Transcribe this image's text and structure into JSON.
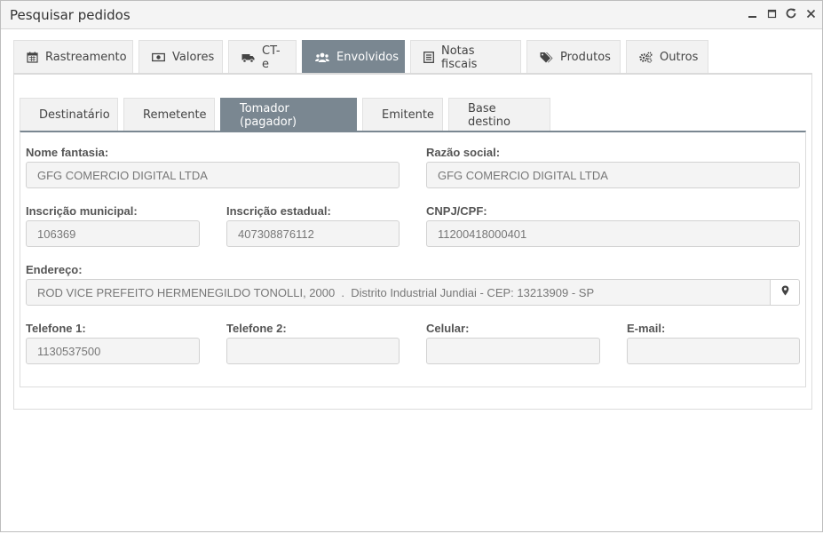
{
  "window": {
    "title": "Pesquisar pedidos",
    "controls": [
      "minimize-icon",
      "maximize-icon",
      "refresh-icon",
      "close-icon"
    ]
  },
  "outer_tabs": [
    {
      "label": "Rastreamento",
      "icon": "calendar-icon"
    },
    {
      "label": "Valores",
      "icon": "money-icon"
    },
    {
      "label": "CT-e",
      "icon": "truck-icon"
    },
    {
      "label": "Envolvidos",
      "icon": "users-icon",
      "active": true
    },
    {
      "label": "Notas fiscais",
      "icon": "list-icon"
    },
    {
      "label": "Produtos",
      "icon": "tags-icon"
    },
    {
      "label": "Outros",
      "icon": "cogs-icon"
    }
  ],
  "inner_tabs": [
    {
      "label": "Destinatário"
    },
    {
      "label": "Remetente"
    },
    {
      "label": "Tomador (pagador)",
      "active": true
    },
    {
      "label": "Emitente"
    },
    {
      "label": "Base destino"
    }
  ],
  "form": {
    "nome_fantasia": {
      "label": "Nome fantasia:",
      "value": "GFG COMERCIO DIGITAL LTDA"
    },
    "razao_social": {
      "label": "Razão social:",
      "value": "GFG COMERCIO DIGITAL LTDA"
    },
    "inscricao_municipal": {
      "label": "Inscrição municipal:",
      "value": "106369"
    },
    "inscricao_estadual": {
      "label": "Inscrição estadual:",
      "value": "407308876112"
    },
    "cnpj_cpf": {
      "label": "CNPJ/CPF:",
      "value": "11200418000401"
    },
    "endereco": {
      "label": "Endereço:",
      "value": "ROD VICE PREFEITO HERMENEGILDO TONOLLI, 2000  .  Distrito Industrial Jundiai - CEP: 13213909 - SP"
    },
    "telefone1": {
      "label": "Telefone 1:",
      "value": "1130537500"
    },
    "telefone2": {
      "label": "Telefone 2:",
      "value": ""
    },
    "celular": {
      "label": "Celular:",
      "value": ""
    },
    "email": {
      "label": "E-mail:",
      "value": ""
    }
  },
  "colors": {
    "active_tab": "#7a8791",
    "tab_bg": "#f2f2f2",
    "field_bg": "#f4f4f4"
  }
}
